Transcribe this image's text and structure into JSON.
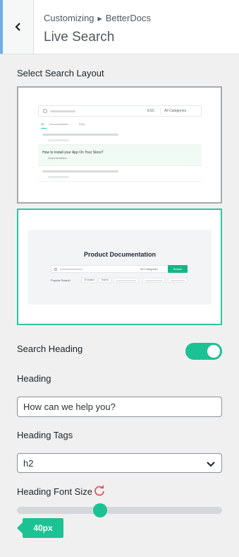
{
  "header": {
    "breadcrumb_parent": "Customizing",
    "breadcrumb_child": "BetterDocs",
    "title": "Live Search"
  },
  "search_layout": {
    "label": "Select Search Layout",
    "selected": 2,
    "layout1": {
      "esc": "ESC",
      "categories": "All Categories",
      "tab_all": "All",
      "tab_docs": "Documentation",
      "tab_faq": "FAQ",
      "highlight_title": "How to install your App On Your Store?",
      "highlight_sub": "Documentation"
    },
    "layout2": {
      "title": "Product Documentation",
      "categories": "All Categories",
      "search_button": "Search",
      "popular_label": "Popular Search",
      "chip1": "On board",
      "chip2": "how to"
    }
  },
  "search_heading": {
    "label": "Search Heading",
    "enabled": true
  },
  "heading": {
    "label": "Heading",
    "value": "How can we help you?"
  },
  "heading_tags": {
    "label": "Heading Tags",
    "value": "h2"
  },
  "heading_font_size": {
    "label": "Heading Font Size",
    "value": "40px"
  },
  "colors": {
    "accent": "#1cc293",
    "selected_border": "#2fc6a0",
    "header_accent": "#72aee6"
  }
}
